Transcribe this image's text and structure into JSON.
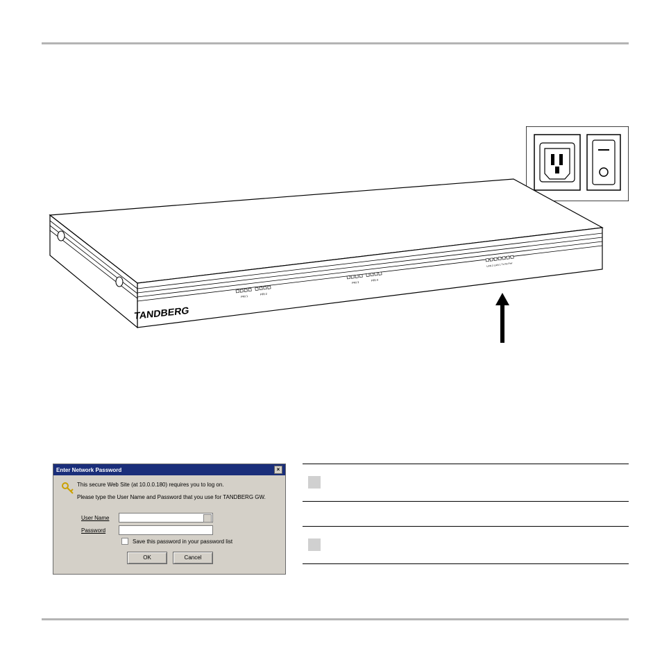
{
  "dialog": {
    "title": "Enter Network Password",
    "line1": "This secure Web Site (at 10.0.0.180) requires you to log on.",
    "line2": "Please type the User Name and Password that you use for TANDBERG GW.",
    "user_label": "User Name",
    "pass_label": "Password",
    "save_label": "Save this password in your password list",
    "ok": "OK",
    "cancel": "Cancel"
  },
  "device_brand": "TANDBERG",
  "led_labels": {
    "group1a": "PRI 1",
    "group1b": "PRI 2",
    "group2a": "PRI 3",
    "group2b": "PRI 4",
    "right": "LAN 2  LAN 1  Tx  Rx  Pwr"
  }
}
